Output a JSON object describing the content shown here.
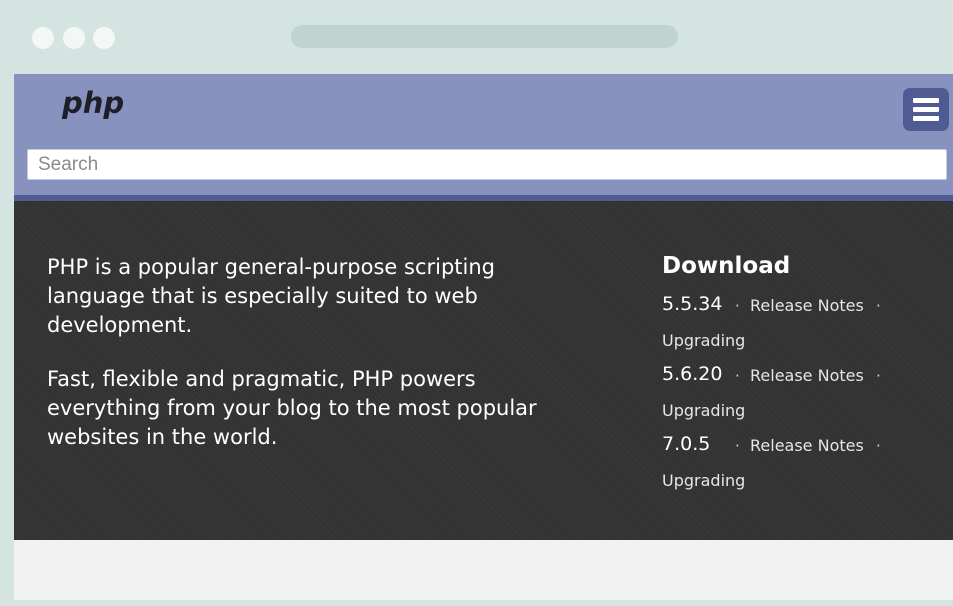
{
  "browser": {
    "window_controls": [
      "close",
      "minimize",
      "maximize"
    ],
    "address_bar": ""
  },
  "header": {
    "logo": "php",
    "menu_icon": "hamburger-menu-icon",
    "background_color": "#8892bf",
    "accent_color": "#4f5b93"
  },
  "search": {
    "value": "",
    "placeholder": "Search"
  },
  "intro": {
    "paragraph_1": "PHP is a popular general-purpose scripting language that is especially suited to web development.",
    "paragraph_2": "Fast, flexible and pragmatic, PHP powers everything from your blog to the most popular websites in the world."
  },
  "download": {
    "title": "Download",
    "separator": "·",
    "releases": [
      {
        "version": "5.5.34",
        "notes_label": "Release Notes",
        "upgrading_label": "Upgrading"
      },
      {
        "version": "5.6.20",
        "notes_label": "Release Notes",
        "upgrading_label": "Upgrading"
      },
      {
        "version": "7.0.5",
        "notes_label": "Release Notes",
        "upgrading_label": "Upgrading"
      }
    ]
  }
}
